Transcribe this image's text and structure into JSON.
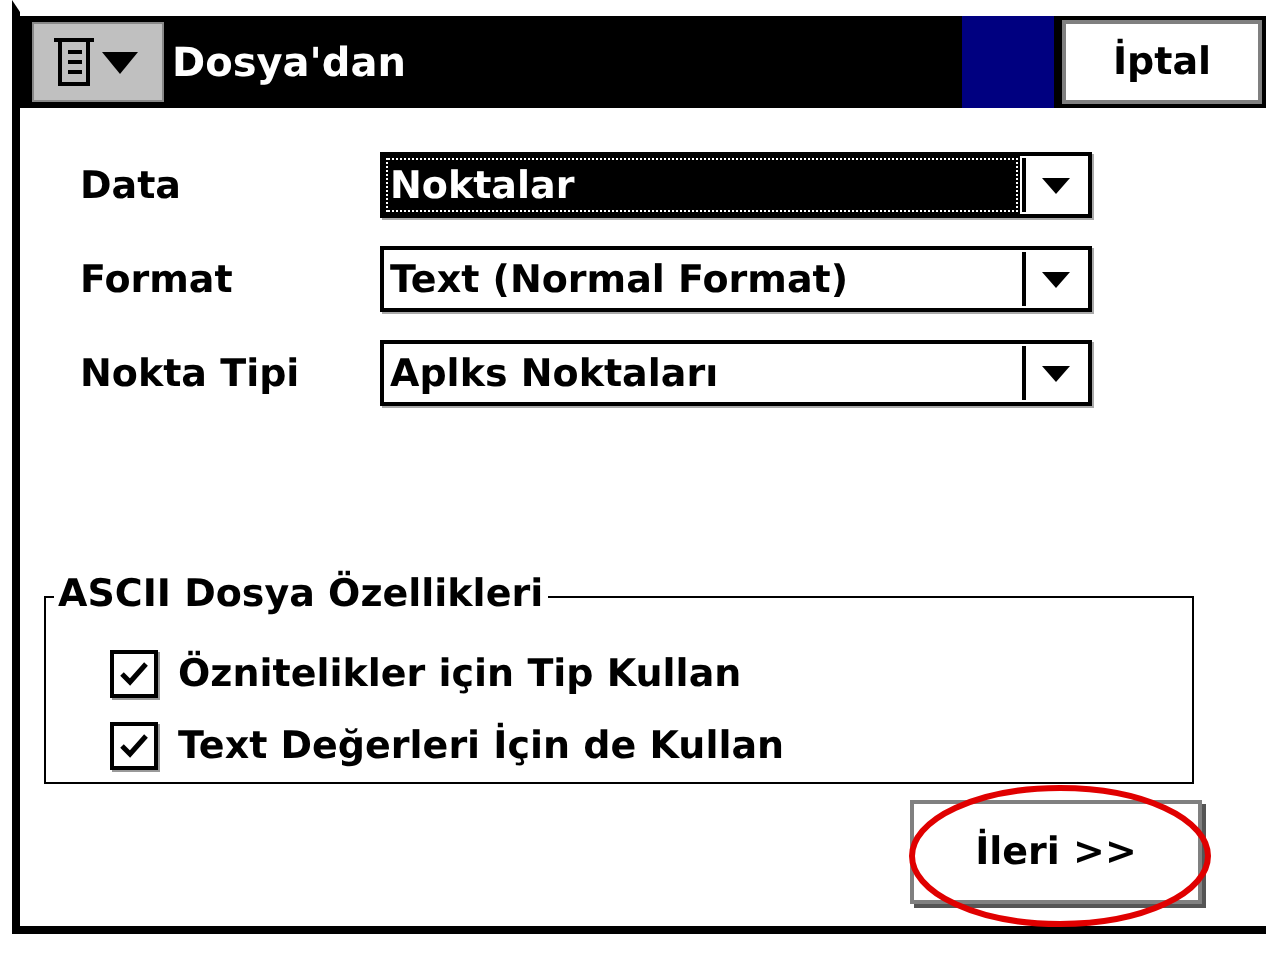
{
  "window": {
    "title": "Dosya'dan",
    "cancel_button": "İptal"
  },
  "fields": [
    {
      "label": "Data",
      "value": "Noktalar",
      "focused": true
    },
    {
      "label": "Format",
      "value": "Text (Normal Format)",
      "focused": false
    },
    {
      "label": "Nokta Tipi",
      "value": "Aplks Noktaları",
      "focused": false
    }
  ],
  "group": {
    "title": "ASCII Dosya Özellikleri",
    "options": [
      {
        "label": "Öznitelikler için Tip Kullan",
        "checked": true
      },
      {
        "label": "Text Değerleri İçin de Kullan",
        "checked": true
      }
    ]
  },
  "next_button": {
    "label": "İleri >>",
    "highlighted": true
  }
}
